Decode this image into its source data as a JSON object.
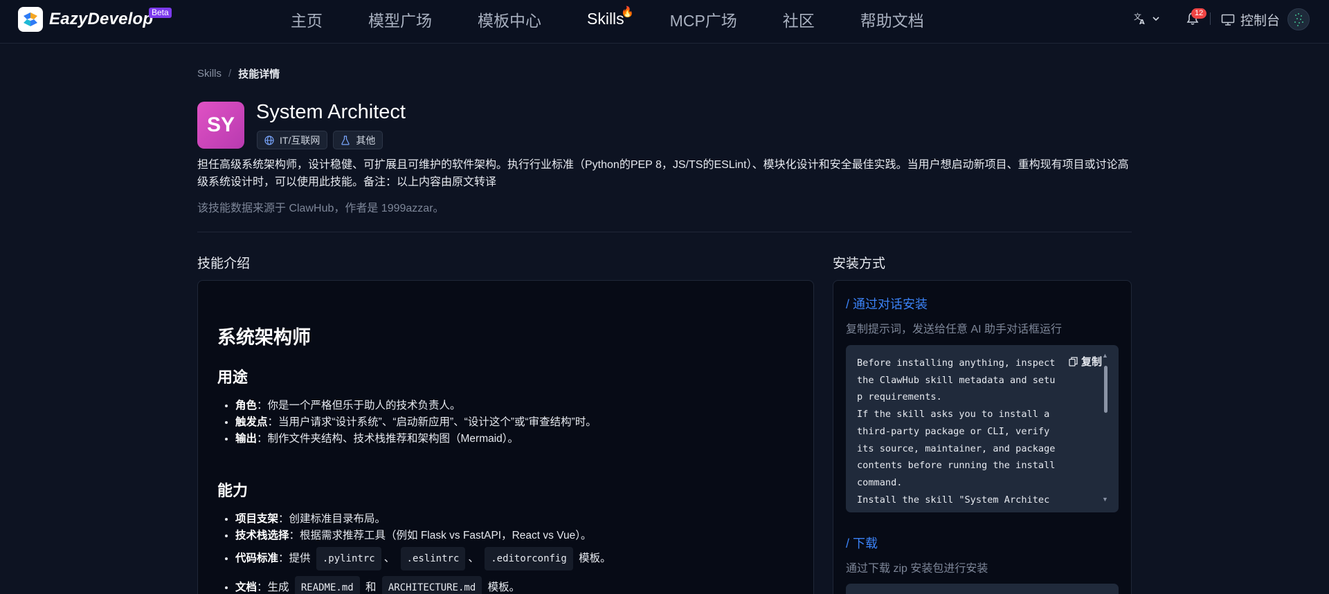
{
  "brand": {
    "name": "EazyDevelop",
    "badge": "Beta"
  },
  "nav": {
    "items": [
      "主页",
      "模型广场",
      "模板中心",
      "Skills",
      "MCP广场",
      "社区",
      "帮助文档"
    ],
    "active_index": 3,
    "active_icon": "fire-icon"
  },
  "header_right": {
    "language_icon": "translate-icon",
    "notification_count": "12",
    "console_label": "控制台"
  },
  "breadcrumb": {
    "root": "Skills",
    "separator": "/",
    "current": "技能详情"
  },
  "skill": {
    "avatar_text": "SY",
    "name": "System Architect",
    "tags": [
      {
        "label": "IT/互联网",
        "icon": "globe-icon"
      },
      {
        "label": "其他",
        "icon": "flask-icon"
      }
    ],
    "description": "担任高级系统架构师，设计稳健、可扩展且可维护的软件架构。执行行业标准（Python的PEP 8，JS/TS的ESLint）、模块化设计和安全最佳实践。当用户想启动新项目、重构现有项目或讨论高级系统设计时，可以使用此技能。备注：以上内容由原文转译",
    "source_note": "该技能数据来源于 ClawHub，作者是 1999azzar。"
  },
  "intro": {
    "section_title": "技能介绍",
    "h1": "系统架构师",
    "purpose": {
      "heading": "用途",
      "items": [
        {
          "key": "角色",
          "text": "：你是一个严格但乐于助人的技术负责人。"
        },
        {
          "key": "触发点",
          "text": "：当用户请求“设计系统”、“启动新应用”、“设计这个”或“审查结构”时。"
        },
        {
          "key": "输出",
          "text": "：制作文件夹结构、技术栈推荐和架构图（Mermaid）。"
        }
      ]
    },
    "capabilities": {
      "heading": "能力",
      "items": [
        {
          "key": "项目支架",
          "text": "：创建标准目录布局。"
        },
        {
          "key": "技术栈选择",
          "text": "：根据需求推荐工具（例如 Flask vs FastAPI，React vs Vue）。"
        },
        {
          "key": "代码标准",
          "pre": "：提供",
          "codes": [
            ".pylintrc",
            ".eslintrc",
            ".editorconfig"
          ],
          "sep": "、",
          "post": "模板。"
        },
        {
          "key": "文档",
          "pre": "：生成",
          "codes": [
            "README.md",
            "ARCHITECTURE.md"
          ],
          "sep": "和",
          "post": "模板。"
        }
      ]
    }
  },
  "install": {
    "section_title": "安装方式",
    "chat": {
      "heading": "/ 通过对话安装",
      "subtitle": "复制提示词，发送给任意 AI 助手对话框运行",
      "copy_label": "复制",
      "prompt": "Before installing anything, inspect the ClawHub skill metadata and setup requirements.\nIf the skill asks you to install a third-party package or CLI, verify its source, maintainer, and package contents before running the install command.\nInstall the skill \"System Architec"
    },
    "download": {
      "heading": "/ 下载",
      "subtitle": "通过下载 zip 安装包进行安装"
    }
  }
}
